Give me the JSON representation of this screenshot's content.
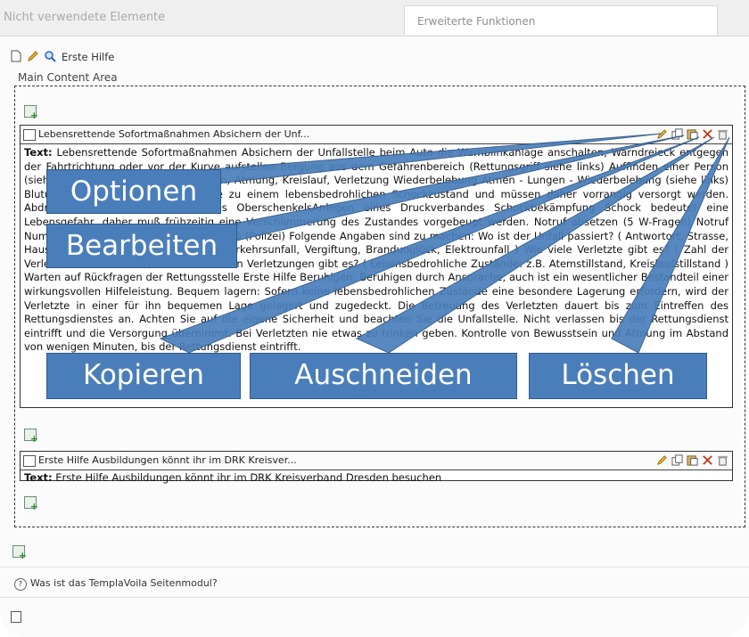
{
  "tabs": {
    "left": "Nicht verwendete Elemente",
    "right": "Erweiterte Funktionen"
  },
  "page": {
    "title": "Erste Hilfe",
    "area_label": "Main Content Area"
  },
  "element1": {
    "header": "Lebensrettende Sofortmaßnahmen Absichern der Unf...",
    "text_label": "Text:",
    "text": " Lebensrettende Sofortmaßnahmen Absichern der Unfallstelle beim Auto die Warnblinkanlage anschalten, Warndreieck entgegen der Fahrtrichtung oder vor der Kurve aufstellen Bergung aus dem Gefahrenbereich (Rettungsgriff siehe links) Auffinden einer Person (siehe links)Kontrolle von: Bewusstsein, Atmung, Kreislauf, Verletzung Wiederbelebung Atmen - Lungen - Wiederbelebung (siehe links) Blutungen stillen Alle Blutungen, die zu einem lebensbedrohlichen Schockzustand und müssen daher vorrangig versorgt werden. Abdrücken des Oberarms oder des OberschenkelsAnlegen eines Druckverbandes Schockbekämpfung Schock bedeutet eine Lebensgefahr, daher muß frühzeitig eine Verschlimmerung des Zustandes vorgebeugt werden. Notruf absetzen (5 W-Fragen) Notruf Nummern (Feuerwehr/Rettungsdienst)110 (Polizei) Folgende Angaben sind zu machen: Wo ist der Unfall passiert? ( Antwortort, Strasse, Hausnr. ) Was ist geschehen? ( z.B.: Verkehrsunfall, Vergiftung, Brandunglück, Elektrounfall ) Wie viele Verletzte gibt es? ( Zahl der Verletzten am Unfallort )Welche Arten von Verletzungen gibt es? ( Lebensbedrohliche Zustände: z.B. Atemstillstand, Kreislaufstillstand ) Warten auf Rückfragen der Rettungsstelle Erste Hilfe Beruhigen: Beruhigen durch Ansprache, auch ist ein wesentlicher Bestandteil einer wirkungsvollen Hilfeleistung. Bequem lagern: Sofern keine lebensbedrohlichen Zustände eine besondere Lagerung erfordern, wird der Verletzte in einer für ihn bequemen Lage gelagert und zugedeckt. Die Betreuung des Verletzten dauert bis zum Eintreffen des Rettungsdienstes an. Achten Sie auf die eigene Sicherheit und beachten Sie die Unfallstelle. Nicht verlassen bis der Rettungsdienst eintrifft und die Versorgung übernimmt. Bei Verletzten nie etwas zu trinken geben. Kontrolle von Bewusstsein und Atmung im Abstand von wenigen Minuten, bis der Rettungsdienst eintrifft."
  },
  "element2": {
    "header": "Erste Hilfe Ausbildungen könnt ihr im DRK Kreisver...",
    "text_label": "Text:",
    "text": " Erste Hilfe Ausbildungen könnt ihr im DRK Kreisverband Dresden besuchen"
  },
  "help": {
    "question": "Was ist das TemplaVoila Seitenmodul?"
  },
  "callouts": {
    "optionen": "Optionen",
    "bearbeiten": "Bearbeiten",
    "kopieren": "Kopieren",
    "auschneiden": "Auschneiden",
    "loeschen": "Löschen"
  },
  "colors": {
    "callout_fill": "#4a7ebb",
    "callout_border": "#2f5a8a"
  },
  "icons": [
    "new-page-icon",
    "pencil-icon",
    "magnifier-icon",
    "new-content-icon",
    "document-icon",
    "copy-icon",
    "paste-icon",
    "cut-icon",
    "trash-icon",
    "help-icon"
  ]
}
